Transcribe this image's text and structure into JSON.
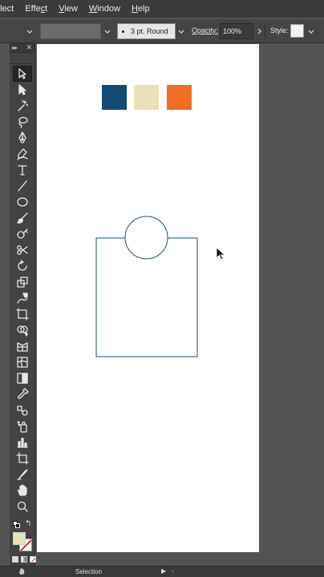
{
  "menu": {
    "items": [
      "elect",
      "Effect",
      "View",
      "Window",
      "Help"
    ],
    "underlines": [
      "e",
      "c",
      "V",
      "W",
      "H"
    ]
  },
  "controlbar": {
    "stroke_profile": "3 pt. Round",
    "opacity_label": "Opacity:",
    "opacity_value": "100%",
    "style_label": "Style:"
  },
  "tools": [
    "selection-tool",
    "direct-selection-tool",
    "magic-wand-tool",
    "lasso-tool",
    "pen-tool",
    "curvature-tool",
    "type-tool",
    "line-segment-tool",
    "ellipse-tool",
    "paintbrush-tool",
    "shaper-tool",
    "scissors-tool",
    "rotate-tool",
    "scale-tool",
    "warp-tool",
    "free-transform-tool",
    "shape-builder-tool",
    "perspective-grid-tool",
    "mesh-tool",
    "gradient-tool",
    "eyedropper-tool",
    "blend-tool",
    "symbol-sprayer-tool",
    "column-graph-tool",
    "artboard-tool",
    "slice-tool",
    "hand-tool",
    "zoom-tool"
  ],
  "active_tool": "selection-tool",
  "fill_color": "#ebe1b8",
  "swatches": [
    {
      "name": "navy",
      "color": "#134a73"
    },
    {
      "name": "cream",
      "color": "#ebe1b8"
    },
    {
      "name": "orange",
      "color": "#ef6e25"
    }
  ],
  "shapes": {
    "stroke_color": "#1b4e76"
  },
  "statusbar": {
    "tool_name": "Selection"
  }
}
